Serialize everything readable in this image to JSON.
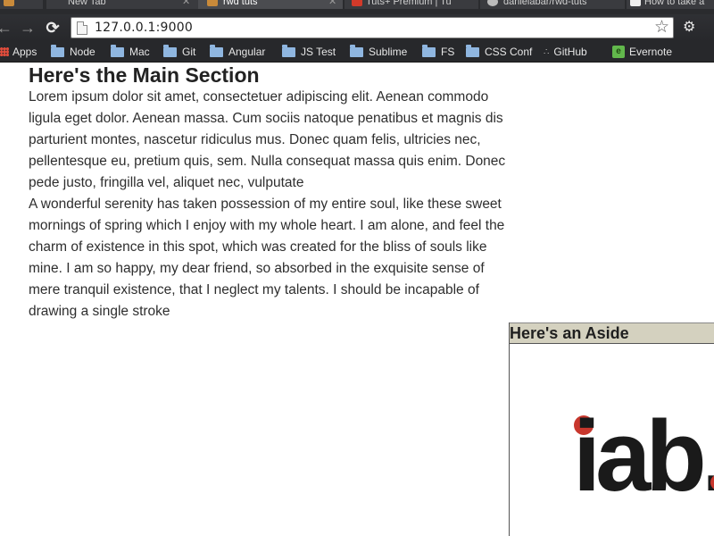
{
  "browser": {
    "tabs": [
      {
        "label": "New Tab",
        "active": false
      },
      {
        "label": "rwd tuts",
        "active": true
      },
      {
        "label": "Tuts+ Premium | Tu",
        "active": false
      },
      {
        "label": "danielabar/rwd-tuts",
        "active": false
      },
      {
        "label": "How to take a",
        "active": false
      }
    ],
    "url": "127.0.0.1:9000",
    "bookmarks": [
      {
        "label": "Apps",
        "icon": "apps-icon"
      },
      {
        "label": "Node",
        "icon": "folder-icon"
      },
      {
        "label": "Mac",
        "icon": "folder-icon"
      },
      {
        "label": "Git",
        "icon": "folder-icon"
      },
      {
        "label": "Angular",
        "icon": "folder-icon"
      },
      {
        "label": "JS Test",
        "icon": "folder-icon"
      },
      {
        "label": "Sublime",
        "icon": "folder-icon"
      },
      {
        "label": "FS",
        "icon": "folder-icon"
      },
      {
        "label": "CSS Conf",
        "icon": "folder-icon"
      },
      {
        "label": "GitHub",
        "icon": "github-icon"
      },
      {
        "label": "Evernote",
        "icon": "evernote-icon"
      }
    ]
  },
  "main": {
    "title": "Here's the Main Section",
    "paragraphs": [
      "Lorem ipsum dolor sit amet, consectetuer adipiscing elit. Aenean commodo ligula eget dolor. Aenean massa. Cum sociis natoque penatibus et magnis dis parturient montes, nascetur ridiculus mus. Donec quam felis, ultricies nec, pellentesque eu, pretium quis, sem. Nulla consequat massa quis enim. Donec pede justo, fringilla vel, aliquet nec, vulputate",
      "A wonderful serenity has taken possession of my entire soul, like these sweet mornings of spring which I enjoy with my whole heart. I am alone, and feel the charm of existence in this spot, which was created for the bliss of souls like mine. I am so happy, my dear friend, so absorbed in the exquisite sense of mere tranquil existence, that I neglect my talents. I should be incapable of drawing a single stroke"
    ]
  },
  "aside": {
    "title": "Here's an Aside",
    "logo_text": "iab."
  },
  "colors": {
    "aside_header_bg": "#d4d1bf",
    "iab_red": "#c8372d",
    "iab_black": "#1a1a1a"
  }
}
